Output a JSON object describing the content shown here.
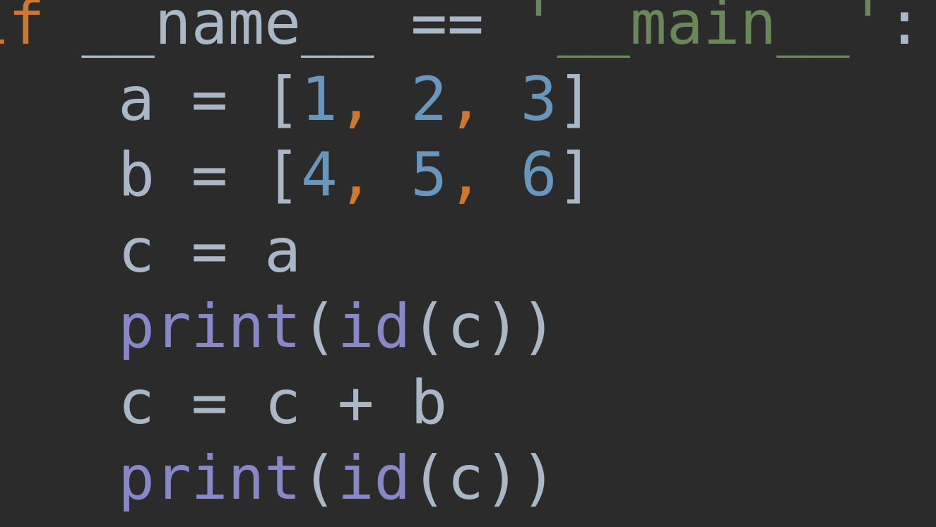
{
  "code": {
    "lines": [
      {
        "indent": "",
        "tokens": [
          {
            "cls": "tok-keyword",
            "text": "if"
          },
          {
            "cls": "tok-ident",
            "text": " __name__ "
          },
          {
            "cls": "tok-op",
            "text": "== "
          },
          {
            "cls": "tok-string",
            "text": "'__main__'"
          },
          {
            "cls": "tok-op",
            "text": ":"
          }
        ]
      },
      {
        "indent": "    ",
        "tokens": [
          {
            "cls": "tok-ident",
            "text": "a "
          },
          {
            "cls": "tok-op",
            "text": "= "
          },
          {
            "cls": "tok-bracket",
            "text": "["
          },
          {
            "cls": "tok-number",
            "text": "1"
          },
          {
            "cls": "tok-comma",
            "text": ", "
          },
          {
            "cls": "tok-number",
            "text": "2"
          },
          {
            "cls": "tok-comma",
            "text": ", "
          },
          {
            "cls": "tok-number",
            "text": "3"
          },
          {
            "cls": "tok-bracket",
            "text": "]"
          }
        ]
      },
      {
        "indent": "    ",
        "tokens": [
          {
            "cls": "tok-ident",
            "text": "b "
          },
          {
            "cls": "tok-op",
            "text": "= "
          },
          {
            "cls": "tok-bracket",
            "text": "["
          },
          {
            "cls": "tok-number",
            "text": "4"
          },
          {
            "cls": "tok-comma",
            "text": ", "
          },
          {
            "cls": "tok-number",
            "text": "5"
          },
          {
            "cls": "tok-comma",
            "text": ", "
          },
          {
            "cls": "tok-number",
            "text": "6"
          },
          {
            "cls": "tok-bracket",
            "text": "]"
          }
        ]
      },
      {
        "indent": "    ",
        "tokens": [
          {
            "cls": "tok-ident",
            "text": "c "
          },
          {
            "cls": "tok-op",
            "text": "= "
          },
          {
            "cls": "tok-ident",
            "text": "a"
          }
        ]
      },
      {
        "indent": "    ",
        "tokens": [
          {
            "cls": "tok-builtin",
            "text": "print"
          },
          {
            "cls": "tok-paren",
            "text": "("
          },
          {
            "cls": "tok-builtin",
            "text": "id"
          },
          {
            "cls": "tok-paren",
            "text": "("
          },
          {
            "cls": "tok-ident",
            "text": "c"
          },
          {
            "cls": "tok-paren",
            "text": "))"
          }
        ]
      },
      {
        "indent": "    ",
        "tokens": [
          {
            "cls": "tok-ident",
            "text": "c "
          },
          {
            "cls": "tok-op",
            "text": "= "
          },
          {
            "cls": "tok-ident",
            "text": "c "
          },
          {
            "cls": "tok-op",
            "text": "+ "
          },
          {
            "cls": "tok-ident",
            "text": "b"
          }
        ]
      },
      {
        "indent": "    ",
        "tokens": [
          {
            "cls": "tok-builtin",
            "text": "print"
          },
          {
            "cls": "tok-paren",
            "text": "("
          },
          {
            "cls": "tok-builtin",
            "text": "id"
          },
          {
            "cls": "tok-paren",
            "text": "("
          },
          {
            "cls": "tok-ident",
            "text": "c"
          },
          {
            "cls": "tok-paren",
            "text": "))"
          }
        ]
      }
    ]
  },
  "colors": {
    "background": "#2b2b2b",
    "default": "#a9b7c6",
    "keyword": "#cc7832",
    "number": "#6897bb",
    "string": "#6a8759",
    "builtin": "#8888c6",
    "comma": "#cc7832"
  }
}
